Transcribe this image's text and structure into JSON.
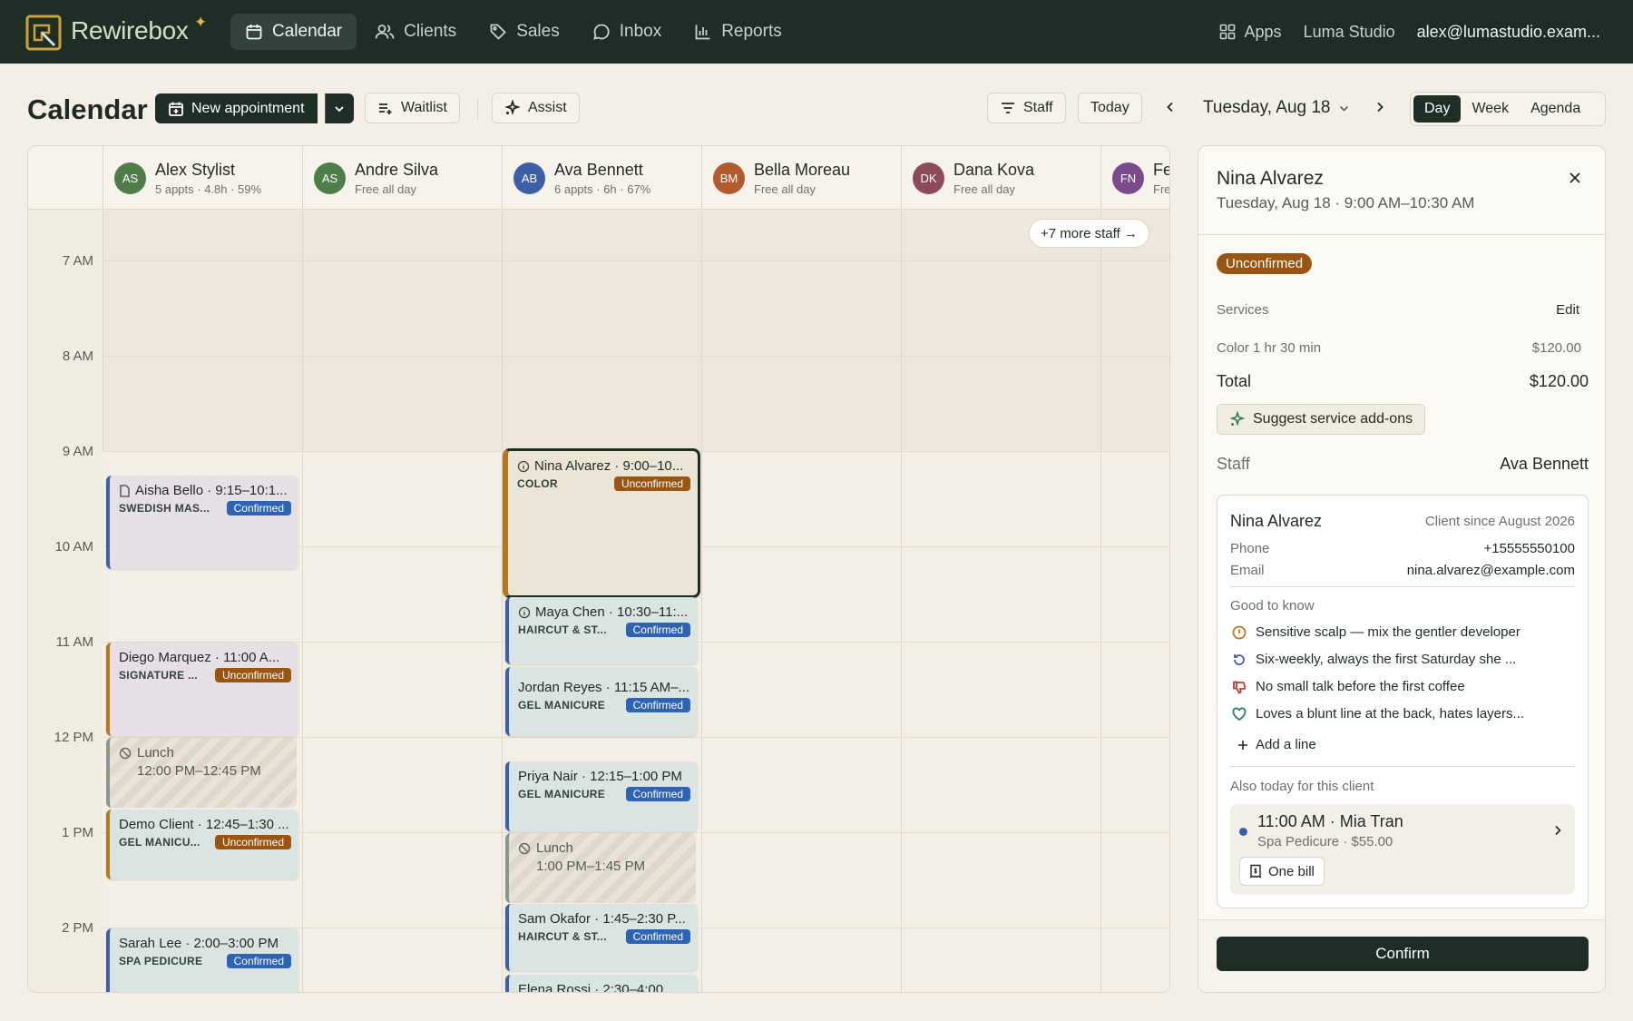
{
  "brand": {
    "name": "Rewirebox"
  },
  "nav": [
    {
      "label": "Calendar",
      "icon": "calendar-icon",
      "active": true
    },
    {
      "label": "Clients",
      "icon": "users-icon"
    },
    {
      "label": "Sales",
      "icon": "tag-icon"
    },
    {
      "label": "Inbox",
      "icon": "chat-icon"
    },
    {
      "label": "Reports",
      "icon": "bar-chart-icon"
    }
  ],
  "topright": {
    "apps": "Apps",
    "studio": "Luma Studio",
    "email": "alex@lumastudio.exam..."
  },
  "toolbar": {
    "title": "Calendar",
    "new_appt": "New appointment",
    "waitlist": "Waitlist",
    "assist": "Assist",
    "staff": "Staff",
    "today": "Today",
    "date": "Tuesday, Aug 18",
    "views": [
      "Day",
      "Week",
      "Agenda"
    ],
    "active_view": "Day"
  },
  "staff": [
    {
      "initials": "AS",
      "name": "Alex Stylist",
      "sub": "5 appts · 4.8h · 59%",
      "color": "#4f7d4a"
    },
    {
      "initials": "AS",
      "name": "Andre Silva",
      "sub": "Free all day",
      "color": "#4f7d4a"
    },
    {
      "initials": "AB",
      "name": "Ava Bennett",
      "sub": "6 appts · 6h · 67%",
      "color": "#3d5fa5"
    },
    {
      "initials": "BM",
      "name": "Bella Moreau",
      "sub": "Free all day",
      "color": "#b35a2e"
    },
    {
      "initials": "DK",
      "name": "Dana Kova",
      "sub": "Free all day",
      "color": "#8d4a5c"
    },
    {
      "initials": "FN",
      "name": "Fe",
      "sub": "Fre",
      "color": "#7a4a8d"
    }
  ],
  "more_staff": "+7 more staff →",
  "times": [
    "7 AM",
    "8 AM",
    "9 AM",
    "10 AM",
    "11 AM",
    "12 PM",
    "1 PM",
    "2 PM"
  ],
  "appointments": {
    "aisha": {
      "title": "Aisha Bello · 9:15–10:1...",
      "service": "SWEDISH MAS...",
      "status": "Confirmed"
    },
    "diego": {
      "title": "Diego Marquez · 11:00 A...",
      "service": "SIGNATURE ...",
      "status": "Unconfirmed"
    },
    "lunch1": {
      "label": "Lunch",
      "time": "12:00 PM–12:45 PM"
    },
    "demo": {
      "title": "Demo Client · 12:45–1:30 ...",
      "service": "GEL MANICU...",
      "status": "Unconfirmed"
    },
    "sarah": {
      "title": "Sarah Lee · 2:00–3:00 PM",
      "service": "SPA PEDICURE",
      "status": "Confirmed"
    },
    "nina": {
      "title": "Nina Alvarez · 9:00–10...",
      "service": "COLOR",
      "status": "Unconfirmed"
    },
    "maya": {
      "title": "Maya Chen · 10:30–11:...",
      "service": "HAIRCUT & ST...",
      "status": "Confirmed"
    },
    "jordan": {
      "title": "Jordan Reyes · 11:15 AM–...",
      "service": "GEL MANICURE",
      "status": "Confirmed"
    },
    "priya": {
      "title": "Priya Nair · 12:15–1:00 PM",
      "service": "GEL MANICURE",
      "status": "Confirmed"
    },
    "lunch2": {
      "label": "Lunch",
      "time": "1:00 PM–1:45 PM"
    },
    "sam": {
      "title": "Sam Okafor · 1:45–2:30 P...",
      "service": "HAIRCUT & ST...",
      "status": "Confirmed"
    },
    "elena": {
      "title": "Elena Rossi · 2:30–4:00"
    }
  },
  "panel": {
    "name": "Nina Alvarez",
    "time": "Tuesday, Aug 18 · 9:00 AM–10:30 AM",
    "status": "Unconfirmed",
    "services_label": "Services",
    "edit": "Edit",
    "service_name": "Color 1 hr 30 min",
    "service_price": "$120.00",
    "total_label": "Total",
    "total": "$120.00",
    "addons": "Suggest service add-ons",
    "staff_label": "Staff",
    "staff_value": "Ava Bennett",
    "client": {
      "name": "Nina Alvarez",
      "since": "Client since August 2026",
      "phone_label": "Phone",
      "phone": "+15555550100",
      "email_label": "Email",
      "email": "nina.alvarez@example.com",
      "good_to_know": "Good to know",
      "notes": [
        {
          "text": "Sensitive scalp — mix the gentler developer",
          "icon": "warning-circle-icon",
          "color": "#b8751f"
        },
        {
          "text": "Six-weekly, always the first Saturday she ...",
          "icon": "repeat-icon",
          "color": "#3d5fa5"
        },
        {
          "text": "No small talk before the first coffee",
          "icon": "thumbs-down-icon",
          "color": "#c0392b"
        },
        {
          "text": "Loves a blunt line at the back, hates layers...",
          "icon": "heart-icon",
          "color": "#2e7d5a"
        }
      ],
      "add_line": "Add a line",
      "also_today": "Also today for this client",
      "also_title": "11:00 AM · Mia Tran",
      "also_sub": "Spa Pedicure · $55.00",
      "one_bill": "One bill"
    },
    "confirm": "Confirm"
  }
}
